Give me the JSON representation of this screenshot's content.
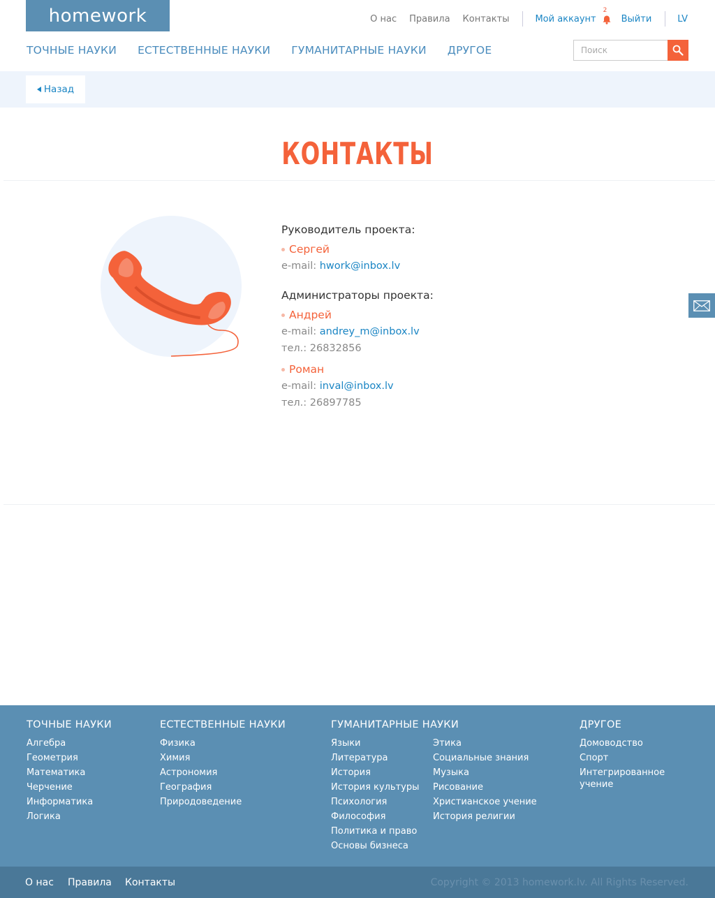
{
  "logo": "homework",
  "topnav": {
    "about": "О нас",
    "rules": "Правила",
    "contacts": "Контакты",
    "account": "Мой аккаунт",
    "notifications": "2",
    "logout": "Выйти",
    "lang": "LV"
  },
  "mainnav": [
    "ТОЧНЫЕ НАУКИ",
    "ЕСТЕСТВЕННЫЕ НАУКИ",
    "ГУМАНИТАРНЫЕ НАУКИ",
    "ДРУГОЕ"
  ],
  "search": {
    "placeholder": "Поиск"
  },
  "back": "Назад",
  "title": "КОНТАКТЫ",
  "contacts": {
    "leader_heading": "Руководитель проекта:",
    "leader": {
      "name": "Сергей",
      "email_label": "e-mail:",
      "email": "hwork@inbox.lv"
    },
    "admins_heading": "Администраторы проекта:",
    "admins": [
      {
        "name": "Андрей",
        "email_label": "e-mail:",
        "email": "andrey_m@inbox.lv",
        "phone_label": "тел.:",
        "phone": "26832856"
      },
      {
        "name": "Роман",
        "email_label": "e-mail:",
        "email": "inval@inbox.lv",
        "phone_label": "тел.:",
        "phone": "26897785"
      }
    ]
  },
  "footer": {
    "exact": {
      "heading": "ТОЧНЫЕ НАУКИ",
      "items": [
        "Алгебра",
        "Геометрия",
        "Математика",
        "Черчение",
        "Информатика",
        "Логика"
      ]
    },
    "natural": {
      "heading": "ЕСТЕСТВЕННЫЕ НАУКИ",
      "items": [
        "Физика",
        "Химия",
        "Астрономия",
        "География",
        "Природоведение"
      ]
    },
    "humanities": {
      "heading": "ГУМАНИТАРНЫЕ НАУКИ",
      "items": [
        "Языки",
        "Литература",
        "История",
        "История культуры",
        "Психология",
        "Философия",
        "Политика и право",
        "Основы бизнеса"
      ]
    },
    "humanities2": {
      "items": [
        "Этика",
        "Социальные знания",
        "Музыка",
        "Рисование",
        "Христианское учение",
        "История религии"
      ]
    },
    "other": {
      "heading": "ДРУГОЕ",
      "items": [
        "Домоводство",
        "Спорт",
        "Интегрированное",
        "учение"
      ]
    },
    "bottom": {
      "about": "О нас",
      "rules": "Правила",
      "contacts": "Контакты",
      "copyright": "Copyright © 2013 homework.lv. All Rights Reserved."
    }
  },
  "colors": {
    "brand": "#5b8fb3",
    "accent": "#f4623a",
    "link": "#1a85c4"
  }
}
